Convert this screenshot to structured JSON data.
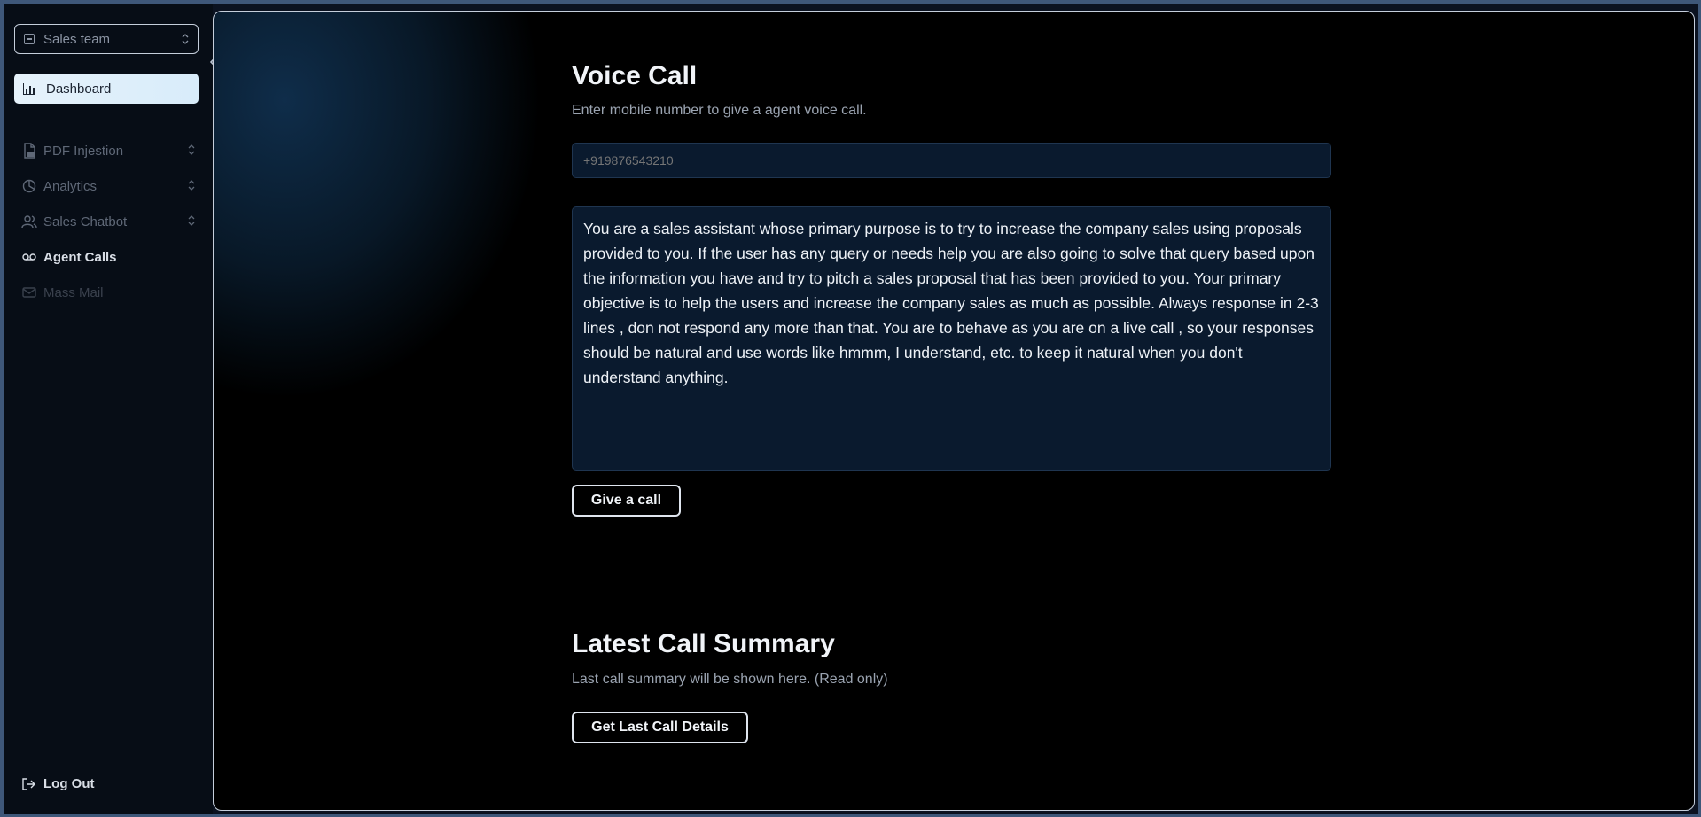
{
  "sidebar": {
    "team_select": {
      "label": "Sales team"
    },
    "dashboard_label": "Dashboard",
    "items": [
      {
        "label": "PDF Injestion",
        "icon": "pdf-file-icon",
        "state": "dim"
      },
      {
        "label": "Analytics",
        "icon": "pie-chart-icon",
        "state": "dim"
      },
      {
        "label": "Sales Chatbot",
        "icon": "users-icon",
        "state": "dim"
      },
      {
        "label": "Agent Calls",
        "icon": "voicemail-icon",
        "state": "active"
      },
      {
        "label": "Mass Mail",
        "icon": "mail-icon",
        "state": "disabled"
      }
    ],
    "logout_label": "Log Out"
  },
  "voice_call": {
    "title": "Voice Call",
    "subtitle": "Enter mobile number to give a agent voice call.",
    "phone_placeholder": "+919876543210",
    "prompt_text": "You are a sales assistant whose primary purpose is to try to increase the company sales using proposals provided to you. If the user has any query or needs help you are also going to solve that query based upon the information you have and try to pitch a sales proposal that has been provided to you. Your primary objective is to help the users and increase the company sales as much as possible. Always response in 2-3 lines , don not respond any more than that. You are to behave as you are on a live call , so your responses should be natural and use words like hmmm, I understand, etc. to keep it natural when you don't understand anything.",
    "call_button": "Give a call"
  },
  "summary": {
    "title": "Latest Call Summary",
    "subtitle": "Last call summary will be shown here. (Read only)",
    "button": "Get Last Call Details"
  },
  "colors": {
    "accent_light": "#e6f2fb",
    "frame": "#3e5779",
    "field_bg": "#0a1a2e"
  }
}
